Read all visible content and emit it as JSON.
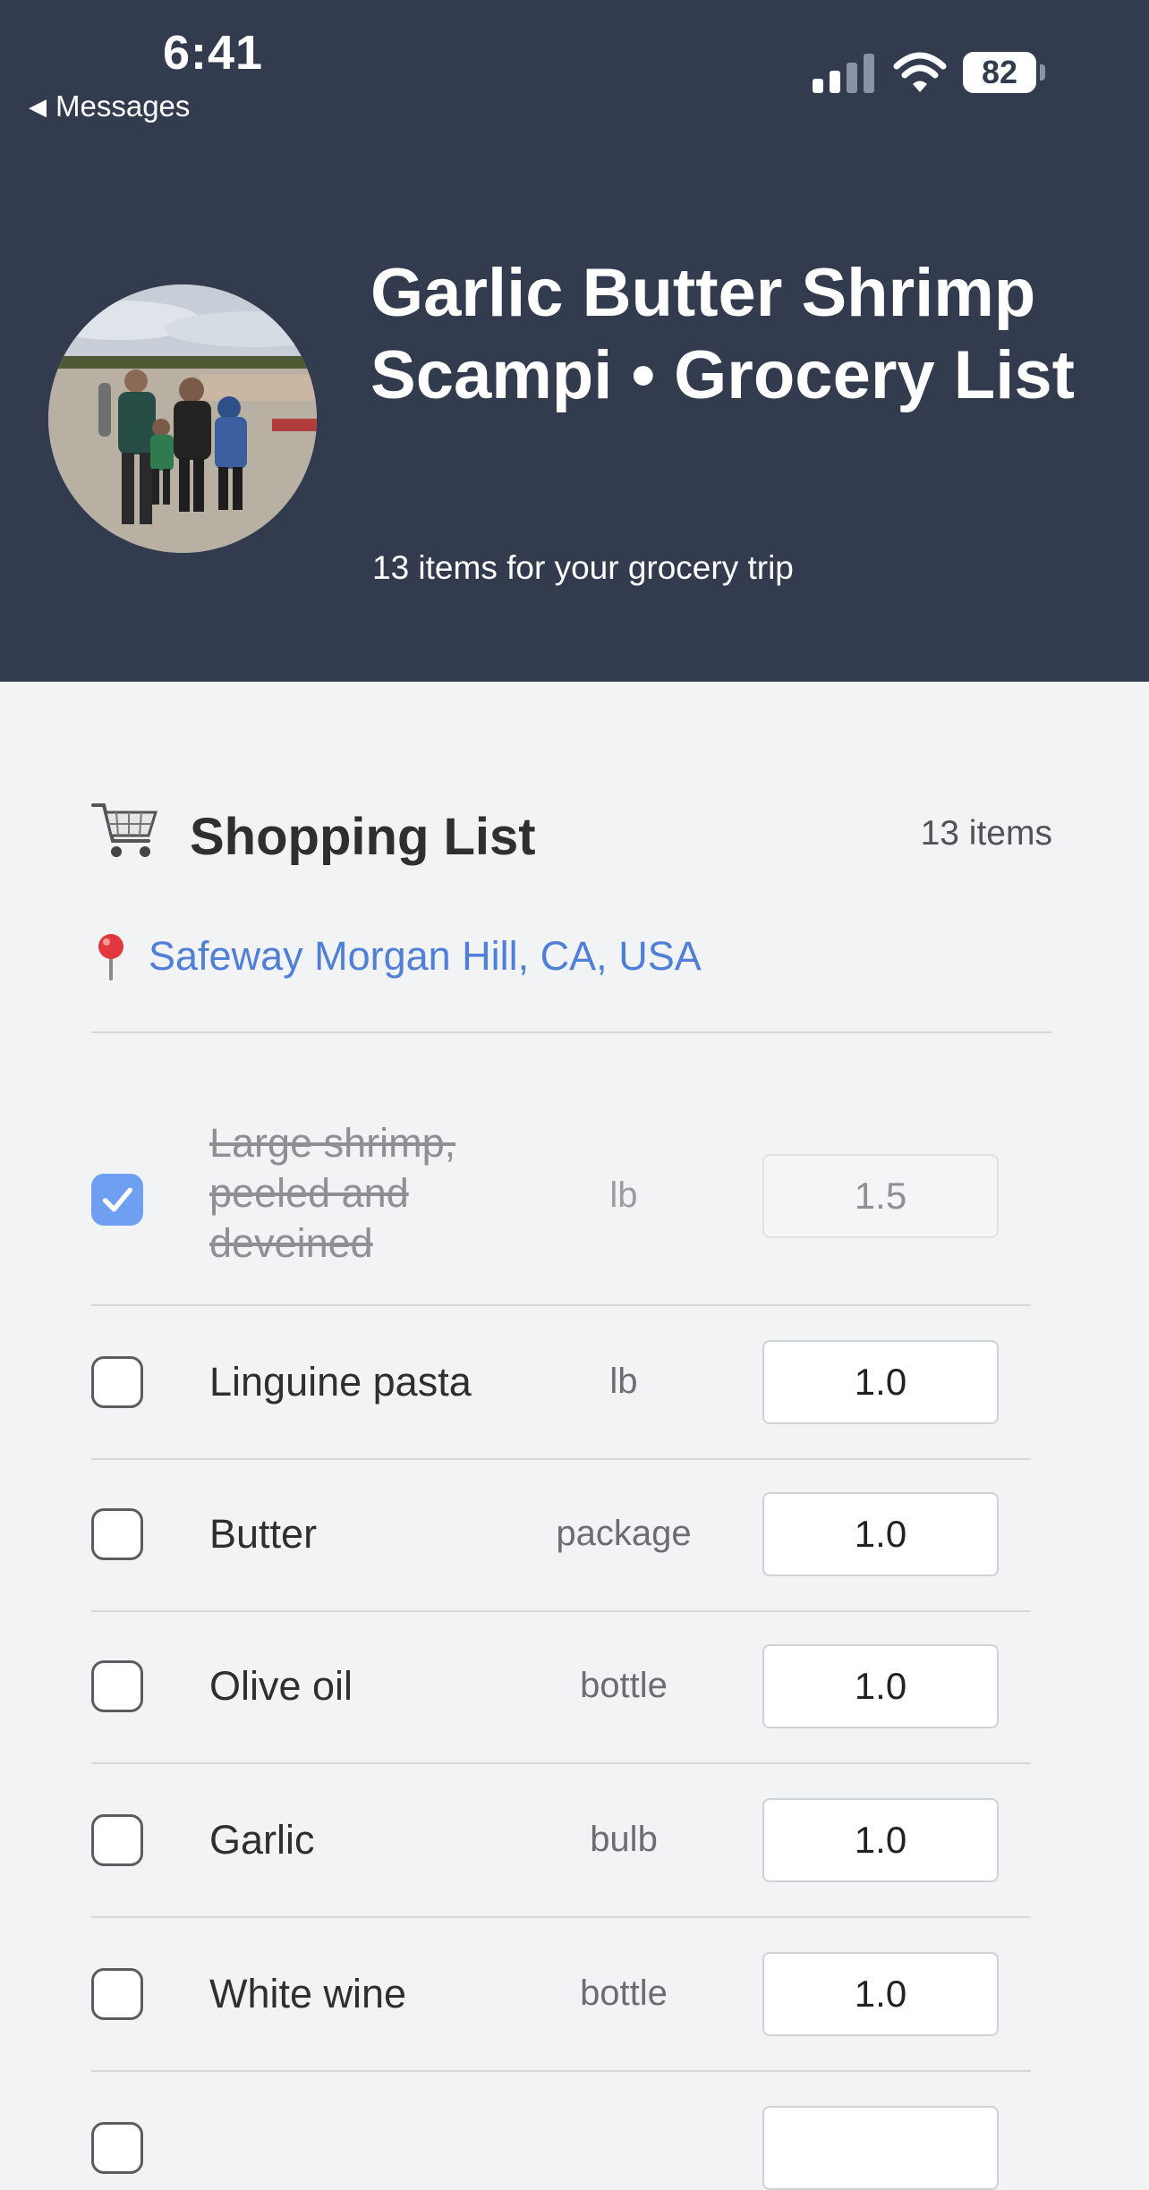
{
  "status_bar": {
    "time": "6:41",
    "back_label": "Messages",
    "battery": "82"
  },
  "header": {
    "title": "Garlic Butter Shrimp Scampi • Grocery List",
    "subtitle": "13 items for your grocery trip"
  },
  "shopping_list": {
    "title": "Shopping List",
    "count_label": "13 items",
    "store": "Safeway Morgan Hill, CA, USA",
    "items": [
      {
        "name": "Large shrimp, peeled and deveined",
        "unit": "lb",
        "qty": "1.5",
        "checked": true
      },
      {
        "name": "Linguine pasta",
        "unit": "lb",
        "qty": "1.0",
        "checked": false
      },
      {
        "name": "Butter",
        "unit": "package",
        "qty": "1.0",
        "checked": false
      },
      {
        "name": "Olive oil",
        "unit": "bottle",
        "qty": "1.0",
        "checked": false
      },
      {
        "name": "Garlic",
        "unit": "bulb",
        "qty": "1.0",
        "checked": false
      },
      {
        "name": "White wine",
        "unit": "bottle",
        "qty": "1.0",
        "checked": false
      }
    ]
  },
  "colors": {
    "header_bg": "#323c4e",
    "page_bg": "#f2f3f5",
    "link": "#4f7fd8",
    "checkbox_checked": "#6e9ff0"
  }
}
